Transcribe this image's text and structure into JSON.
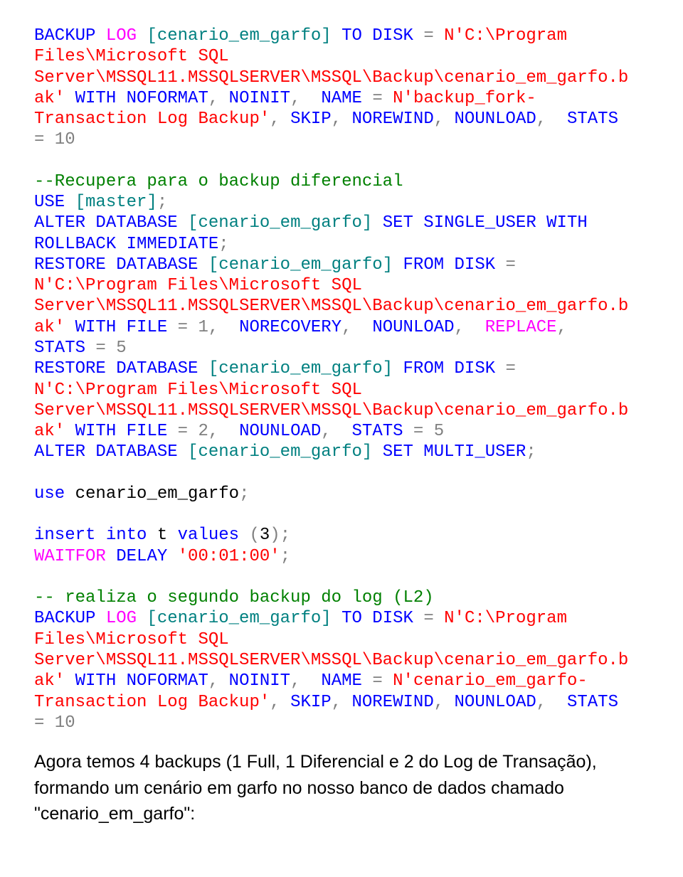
{
  "code": {
    "t0": "BACKUP",
    "t1": " LOG",
    "t2": " [cenario_em_garfo]",
    "t3": " TO",
    "t4": " DISK",
    "t5": " = ",
    "t6": "N'C:\\Program Files\\Microsoft SQL Server\\MSSQL11.MSSQLSERVER\\MSSQL\\Backup\\cenario_em_garfo.bak'",
    "t7": " WITH ",
    "t8": "NOFORMAT",
    "t9": ", ",
    "t10": "NOINIT",
    "t11": ",  ",
    "t12": "NAME",
    "t13": " = ",
    "t14": "N'backup_fork-Transaction Log Backup'",
    "t15": ", ",
    "t16": "SKIP",
    "t17": ", ",
    "t18": "NOREWIND",
    "t19": ", ",
    "t20": "NOUNLOAD",
    "t21": ",  ",
    "t22": "STATS",
    "t23": " = 10",
    "c1": "--Recupera para o backup diferencial",
    "u1a": "USE",
    "u1b": " [master]",
    "u1c": ";",
    "a1a": "ALTER",
    "a1b": " DATABASE",
    "a1c": " [cenario_em_garfo]",
    "a1d": " SET",
    "a1e": " SINGLE_USER",
    "a1f": " WITH",
    "a1g": " ROLLBACK",
    "a1h": " IMMEDIATE",
    "a1i": ";",
    "r1a": "RESTORE",
    "r1b": " DATABASE",
    "r1c": " [cenario_em_garfo]",
    "r1d": " FROM",
    "r1e": " DISK",
    "r1f": " = ",
    "r1g": "N'C:\\Program Files\\Microsoft SQL Server\\MSSQL11.MSSQLSERVER\\MSSQL\\Backup\\cenario_em_garfo.bak'",
    "r1h": " WITH ",
    "r1i": "FILE",
    "r1j": " = 1,  ",
    "r1k": "NORECOVERY",
    "r1l": ",  ",
    "r1m": "NOUNLOAD",
    "r1n": ",  ",
    "r1o": "REPLACE",
    "r1p": ",  ",
    "r1q": "STATS",
    "r1r": " = 5",
    "r2a": "RESTORE",
    "r2b": " DATABASE",
    "r2c": " [cenario_em_garfo]",
    "r2d": " FROM",
    "r2e": " DISK",
    "r2f": " = ",
    "r2g": "N'C:\\Program Files\\Microsoft SQL Server\\MSSQL11.MSSQLSERVER\\MSSQL\\Backup\\cenario_em_garfo.bak'",
    "r2h": " WITH ",
    "r2i": "FILE",
    "r2j": " = 2,  ",
    "r2k": "NOUNLOAD",
    "r2l": ",  ",
    "r2m": "STATS",
    "r2n": " = 5",
    "a2a": "ALTER",
    "a2b": " DATABASE",
    "a2c": " [cenario_em_garfo]",
    "a2d": " SET",
    "a2e": " MULTI_USER",
    "a2f": ";",
    "u2a": "use",
    "u2b": " cenario_em_garfo",
    "u2c": ";",
    "i1a": "insert",
    "i1b": " into",
    "i1c": " t ",
    "i1d": "values",
    "i1e": " (",
    "i1f": "3",
    "i1g": ");",
    "w1a": "WAITFOR",
    "w1b": " DELAY",
    "w1c": " '00:01:00'",
    "w1d": ";",
    "c2": "-- realiza o segundo backup do log (L2)",
    "b2a": "BACKUP",
    "b2b": " LOG",
    "b2c": " [cenario_em_garfo]",
    "b2d": " TO",
    "b2e": " DISK",
    "b2f": " = ",
    "b2g": "N'C:\\Program Files\\Microsoft SQL Server\\MSSQL11.MSSQLSERVER\\MSSQL\\Backup\\cenario_em_garfo.bak'",
    "b2h": " WITH ",
    "b2i": "NOFORMAT",
    "b2j": ", ",
    "b2k": "NOINIT",
    "b2l": ",  ",
    "b2m": "NAME",
    "b2n": " = ",
    "b2o": "N'cenario_em_garfo-Transaction Log Backup'",
    "b2p": ", ",
    "b2q": "SKIP",
    "b2r": ", ",
    "b2s": "NOREWIND",
    "b2t": ", ",
    "b2u": "NOUNLOAD",
    "b2v": ",  ",
    "b2w": "STATS",
    "b2x": " = 10"
  },
  "p1": "Agora temos 4 backups (1 Full, 1 Diferencial e 2 do Log de Transação), formando um cenário em garfo no nosso banco de dados chamado \"cenario_em_garfo\":"
}
